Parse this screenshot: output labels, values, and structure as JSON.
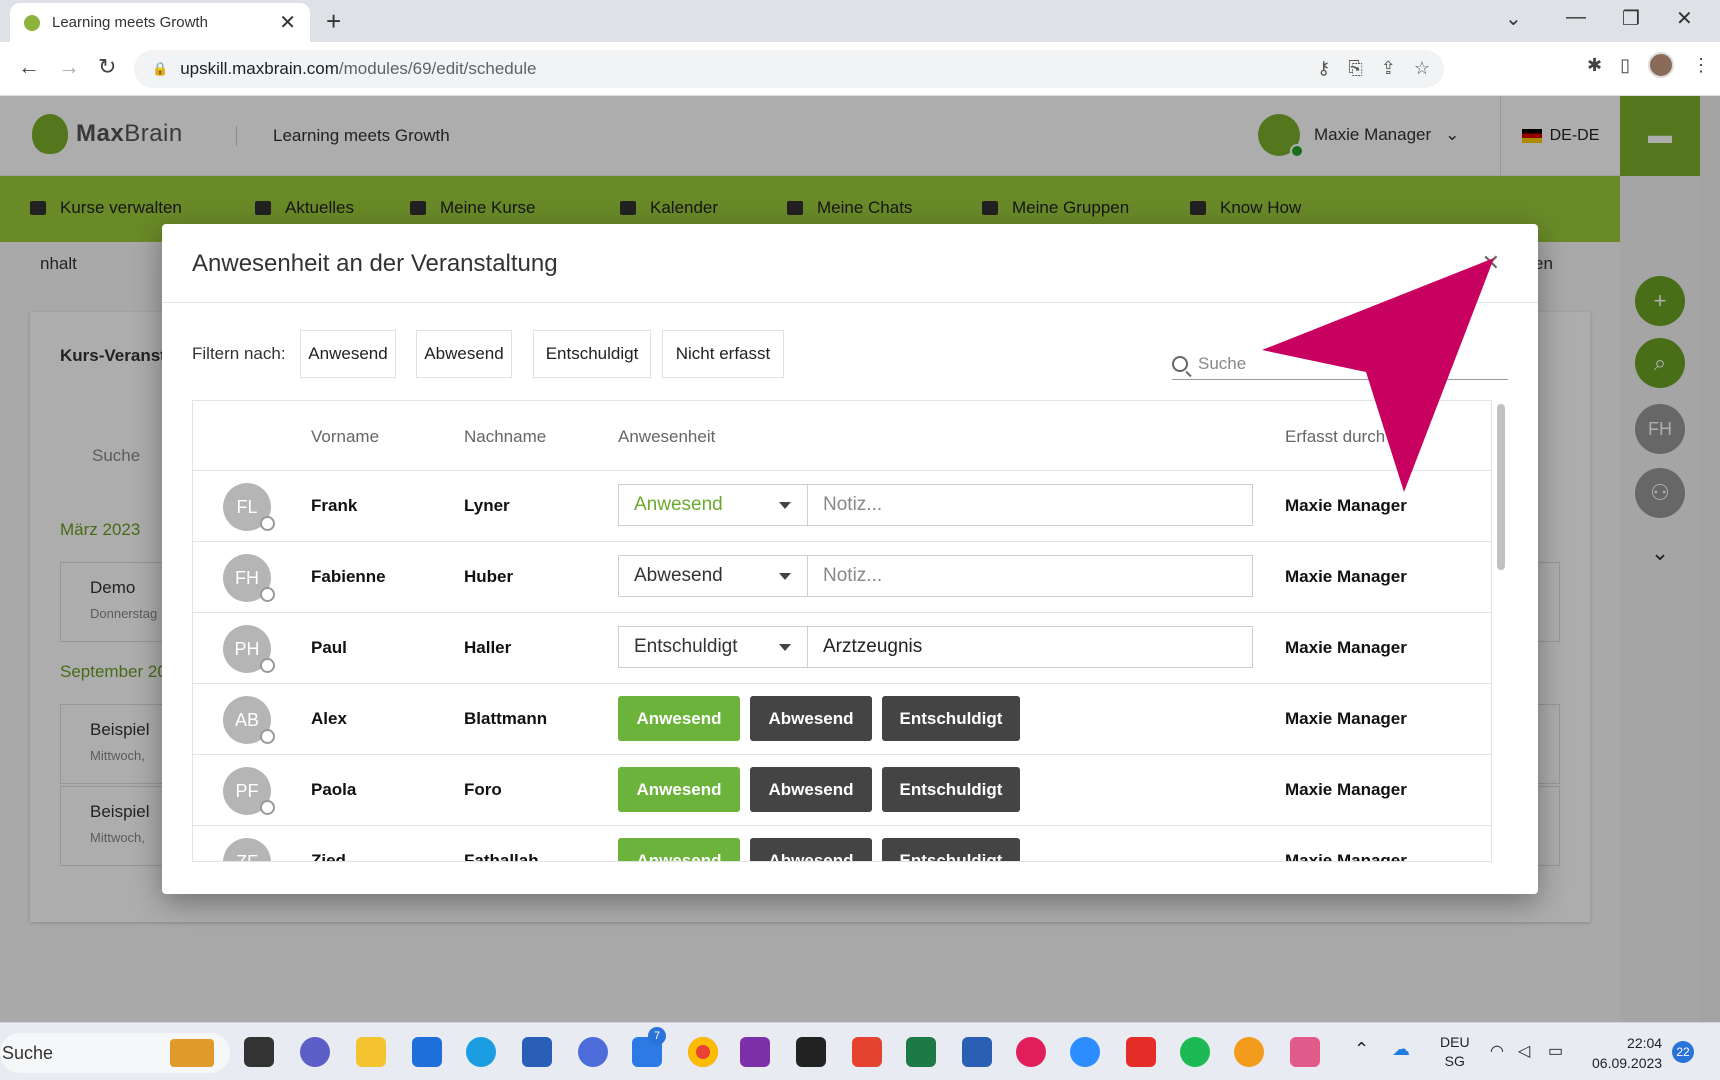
{
  "browser": {
    "tab_title": "Learning meets Growth",
    "url_host": "upskill.maxbrain.com",
    "url_path": "/modules/69/edit/schedule"
  },
  "app": {
    "logo_bold": "Max",
    "logo_light": "Brain",
    "tagline": "Learning meets Growth",
    "user_name": "Maxie Manager",
    "language": "DE-DE",
    "nav": [
      "Kurse verwalten",
      "Aktuelles",
      "Meine Kurse",
      "Kalender",
      "Meine Chats",
      "Meine Gruppen",
      "Know How"
    ],
    "rail_avatar": "FH",
    "background": {
      "tab_partial": "nhalt",
      "tab_partial_right": "en",
      "card_title_partial": "Kurs-Veranst",
      "search_placeholder": "Suche",
      "month_1": "März 2023",
      "item_1_title": "Demo",
      "item_1_sub": "Donnerstag",
      "month_2": "September 20",
      "item_2_title": "Beispiel",
      "item_2_sub": "Mittwoch,",
      "item_3_title": "Beispiel",
      "item_3_sub": "Mittwoch,"
    }
  },
  "modal": {
    "title": "Anwesenheit an der Veranstaltung",
    "close_glyph": "✕",
    "filter_label": "Filtern nach:",
    "filters": [
      "Anwesend",
      "Abwesend",
      "Entschuldigt",
      "Nicht erfasst"
    ],
    "search_placeholder": "Suche",
    "columns": [
      "Vorname",
      "Nachname",
      "Anwesenheit",
      "Erfasst durch"
    ],
    "note_placeholder": "Notiz...",
    "rows": [
      {
        "initials": "FL",
        "first": "Frank",
        "last": "Lyner",
        "mode": "select",
        "status": "Anwesend",
        "note": "",
        "by": "Maxie Manager"
      },
      {
        "initials": "FH",
        "first": "Fabienne",
        "last": "Huber",
        "mode": "select",
        "status": "Abwesend",
        "note": "",
        "by": "Maxie Manager"
      },
      {
        "initials": "PH",
        "first": "Paul",
        "last": "Haller",
        "mode": "select",
        "status": "Entschuldigt",
        "note": "Arztzeugnis",
        "by": "Maxie Manager"
      },
      {
        "initials": "AB",
        "first": "Alex",
        "last": "Blattmann",
        "mode": "buttons",
        "by": "Maxie Manager"
      },
      {
        "initials": "PF",
        "first": "Paola",
        "last": "Foro",
        "mode": "buttons",
        "by": "Maxie Manager"
      },
      {
        "initials": "ZF",
        "first": "Zied",
        "last": "Fathallah",
        "mode": "buttons",
        "by": "Maxie Manager"
      }
    ],
    "action_buttons": [
      "Anwesend",
      "Abwesend",
      "Entschuldigt"
    ]
  },
  "taskbar": {
    "search": "Suche",
    "lang_1": "DEU",
    "lang_2": "SG",
    "time": "22:04",
    "date": "06.09.2023",
    "notifications": "22",
    "badge": "7"
  },
  "colors": {
    "brand_green": "#9ccc3c",
    "button_green": "#6bb33b",
    "button_dark": "#444444",
    "annotation_arrow": "#c8005f"
  }
}
